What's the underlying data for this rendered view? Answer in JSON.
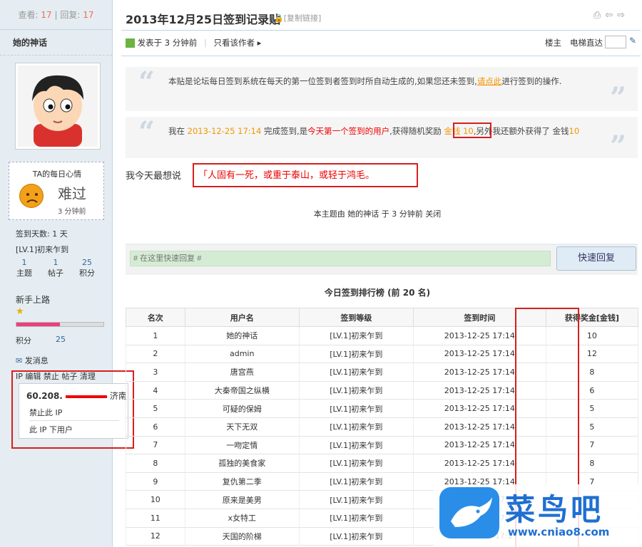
{
  "sidebar": {
    "view_label": "查看:",
    "views": "17",
    "sep": "|",
    "reply_label": "回复:",
    "replies": "17",
    "author": "她的神话",
    "mood_title": "TA的每日心情",
    "mood_text": "难过",
    "mood_time": "3 分钟前",
    "sign_days": "签到天数: 1 天",
    "level": "[LV.1]初来乍到",
    "counts": [
      {
        "v": "1",
        "l": "主题"
      },
      {
        "v": "1",
        "l": "帖子"
      },
      {
        "v": "25",
        "l": "积分"
      }
    ],
    "rank": "新手上路",
    "points_label": "积分",
    "points": "25",
    "progress": 0.5,
    "message": "发消息",
    "admin_links": "IP 编辑 禁止 帖子 清理",
    "ip": "60.208.",
    "ip_loc": "济南",
    "ban_ip": "禁止此 IP",
    "ip_users": "此 IP 下用户"
  },
  "post": {
    "title": "2013年12月25日签到记录贴",
    "copy": "[复制链接]",
    "posted": "发表于 3 分钟前",
    "only_author": "只看该作者",
    "floor": "楼主",
    "jump": "电梯直达",
    "q1a": "本贴是论坛每日签到系统在每天的第一位签到者签到时所自动生成的,如果您还未签到,",
    "q1link": "请点此",
    "q1b": "进行签到的操作.",
    "q2a": "我在 ",
    "q2time": "2013-12-25 17:14",
    "q2b": " 完成签到,是",
    "q2first": "今天第一个签到的用户",
    "q2c": ",获得随机奖励 ",
    "q2reward": "金钱 10",
    "q2d": ",另外我还额外获得了 金钱",
    "q2extra": "10",
    "say_label": "我今天最想说",
    "say": "「人固有一死，或重于泰山，或轻于鸿毛。",
    "closed": "本主题由 她的神话 于 3 分钟前 关闭",
    "reply_placeholder": "# 在这里快速回复 #",
    "reply_btn": "快速回复",
    "board_title": "今日签到排行榜 (前 20 名)"
  },
  "table": {
    "headers": [
      "名次",
      "用户名",
      "签到等级",
      "签到时间",
      "获得奖金[金钱]"
    ],
    "rows": [
      [
        "1",
        "她的神话",
        "[LV.1]初来乍到",
        "2013-12-25 17:14",
        "10"
      ],
      [
        "2",
        "admin",
        "[LV.1]初来乍到",
        "2013-12-25 17:14",
        "12"
      ],
      [
        "3",
        "唐宫燕",
        "[LV.1]初来乍到",
        "2013-12-25 17:14",
        "8"
      ],
      [
        "4",
        "大秦帝国之纵横",
        "[LV.1]初来乍到",
        "2013-12-25 17:14",
        "6"
      ],
      [
        "5",
        "可疑的保姆",
        "[LV.1]初来乍到",
        "2013-12-25 17:14",
        "5"
      ],
      [
        "6",
        "天下无双",
        "[LV.1]初来乍到",
        "2013-12-25 17:14",
        "5"
      ],
      [
        "7",
        "一吻定情",
        "[LV.1]初来乍到",
        "2013-12-25 17:14",
        "7"
      ],
      [
        "8",
        "孤独的美食家",
        "[LV.1]初来乍到",
        "2013-12-25 17:14",
        "8"
      ],
      [
        "9",
        "复仇第二季",
        "[LV.1]初来乍到",
        "2013-12-25 17:14",
        "7"
      ],
      [
        "10",
        "原来是美男",
        "[LV.1]初来乍到",
        "2013-12-25 17:1",
        ""
      ],
      [
        "11",
        "x女特工",
        "[LV.1]初来乍到",
        "2013-12-25 17:1",
        ""
      ],
      [
        "12",
        "天国的阶梯",
        "[LV.1]初来乍到",
        "2013-12-25 17:1",
        ""
      ]
    ]
  },
  "watermark": {
    "brand": "菜鸟吧",
    "url": "www.cniao8.com"
  },
  "colors": {
    "accent": "#f26c4f",
    "highlight": "#d61f1f",
    "sidebar": "#e5edf2"
  }
}
